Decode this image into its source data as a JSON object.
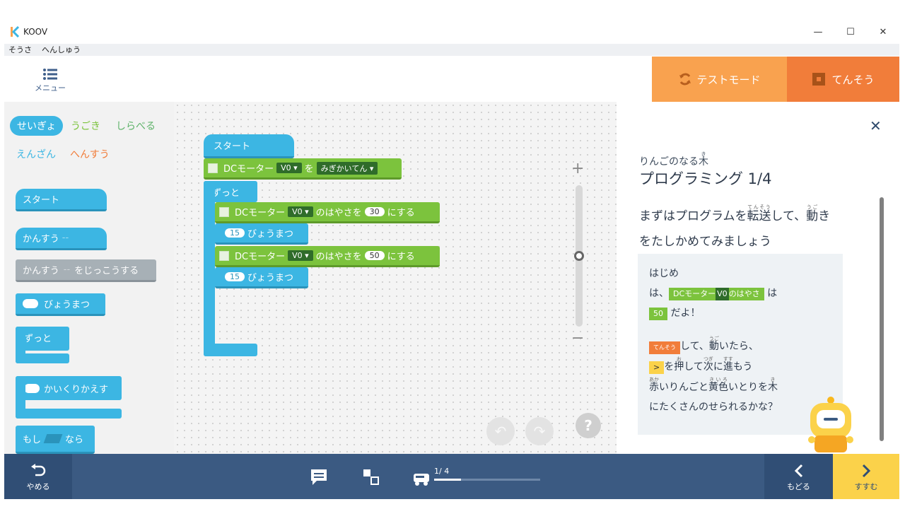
{
  "window": {
    "title": "KOOV",
    "minimize": "—",
    "maximize": "☐",
    "close": "✕"
  },
  "menubar": {
    "items": [
      "そうさ",
      "へんしゅう"
    ]
  },
  "toolbar": {
    "menu_label": "メニュー",
    "test_mode_label": "テストモード",
    "send_label": "てんそう"
  },
  "palette": {
    "categories": [
      {
        "label": "せいぎょ",
        "color": "#ffffff",
        "active": true
      },
      {
        "label": "うごき",
        "color": "#7cc33d"
      },
      {
        "label": "しらべる",
        "color": "#5fb36a"
      },
      {
        "label": "えんざん",
        "color": "#3cb6e3"
      },
      {
        "label": "へんすう",
        "color": "#f17d3a"
      }
    ],
    "blocks": {
      "start": "スタート",
      "function": "かんすう",
      "function_dash": "--",
      "run_function_pre": "かんすう",
      "run_function_dash": "--",
      "run_function_post": "をじっこうする",
      "wait": "びょうまつ",
      "forever": "ずっと",
      "repeat": "かいくりかえす",
      "if_pre": "もし",
      "if_post": "なら"
    }
  },
  "workspace": {
    "start": "スタート",
    "motor_dir": {
      "label": "DCモーター",
      "port": "V0",
      "mid": "を",
      "dir": "みぎかいてん"
    },
    "forever": "ずっと",
    "speed1": {
      "label": "DCモーター",
      "port": "V0",
      "mid": "のはやさを",
      "value": "30",
      "post": "にする"
    },
    "wait1": {
      "value": "15",
      "label": "びょうまつ"
    },
    "speed2": {
      "label": "DCモーター",
      "port": "V0",
      "mid": "のはやさを",
      "value": "50",
      "post": "にする"
    },
    "wait2": {
      "value": "15",
      "label": "びょうまつ"
    },
    "zoom_in": "+",
    "zoom_out": "−",
    "zoom_level": 0.5,
    "help": "?"
  },
  "panel": {
    "subtitle": "りんごのなる",
    "subtitle_kanji": "木",
    "subtitle_ruby": "き",
    "title": "プログラミング 1/4",
    "desc_a": "まずはプログラムを",
    "desc_tensou": "転送",
    "desc_tensou_ruby": "てんそう",
    "desc_b": "して、",
    "desc_ugoki": "動",
    "desc_ugoki_ruby": "うご",
    "desc_c": "き",
    "desc_d": "をたしかめてみましょう",
    "story": {
      "l1": "はじめ",
      "l2_pre": "は、",
      "l2_tag_a": "DCモーター",
      "l2_tag_port": "V0",
      "l2_tag_b": "のはやさ",
      "l2_post": " は",
      "l3_num": "50",
      "l3_post": " だよ！",
      "l4_tag": "てんそう",
      "l4_a": "して、",
      "l4_k": "動",
      "l4_r": "うご",
      "l4_b": "いたら、",
      "l5_tag": ">",
      "l5_a": "を",
      "l5_k1": "押",
      "l5_r1": "お",
      "l5_b": "して",
      "l5_k2": "次",
      "l5_r2": "つぎ",
      "l5_c": "に",
      "l5_k3": "進",
      "l5_r3": "すす",
      "l5_d": "もう",
      "l6_k1": "赤",
      "l6_r1": "あか",
      "l6_a": "いりんごと",
      "l6_k2": "黄色",
      "l6_r2": "きいろ",
      "l6_b": "いとりを",
      "l6_k3": "木",
      "l6_r3": "き",
      "l7": "にたくさんのせられるかな？"
    },
    "close": "✕"
  },
  "bottombar": {
    "quit_label": "やめる",
    "progress_label": "1/ 4",
    "progress": 0.25,
    "back_label": "もどる",
    "next_label": "すすむ"
  },
  "colors": {
    "accent_blue": "#3cb6e3",
    "accent_green": "#7cc33d",
    "test_orange": "#f9a24f",
    "send_orange": "#f17d3a",
    "nav_blue": "#3b5a82",
    "next_yellow": "#fbd24a"
  }
}
